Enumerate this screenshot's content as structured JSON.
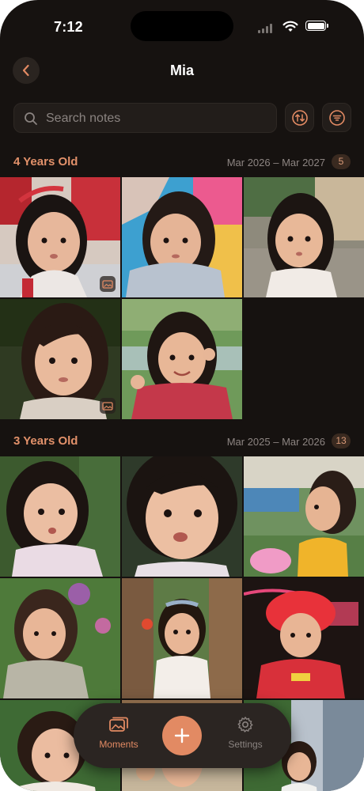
{
  "status": {
    "time": "7:12"
  },
  "header": {
    "title": "Mia"
  },
  "search": {
    "placeholder": "Search notes"
  },
  "sections": [
    {
      "name": "4 Years Old",
      "range": "Mar 2026 – Mar 2027",
      "count": "5"
    },
    {
      "name": "3 Years Old",
      "range": "Mar 2025 – Mar 2026",
      "count": "13"
    }
  ],
  "tabbar": {
    "moments": "Moments",
    "settings": "Settings"
  },
  "colors": {
    "accent": "#e28a63",
    "background": "#161210",
    "section_title": "#e2916a"
  }
}
